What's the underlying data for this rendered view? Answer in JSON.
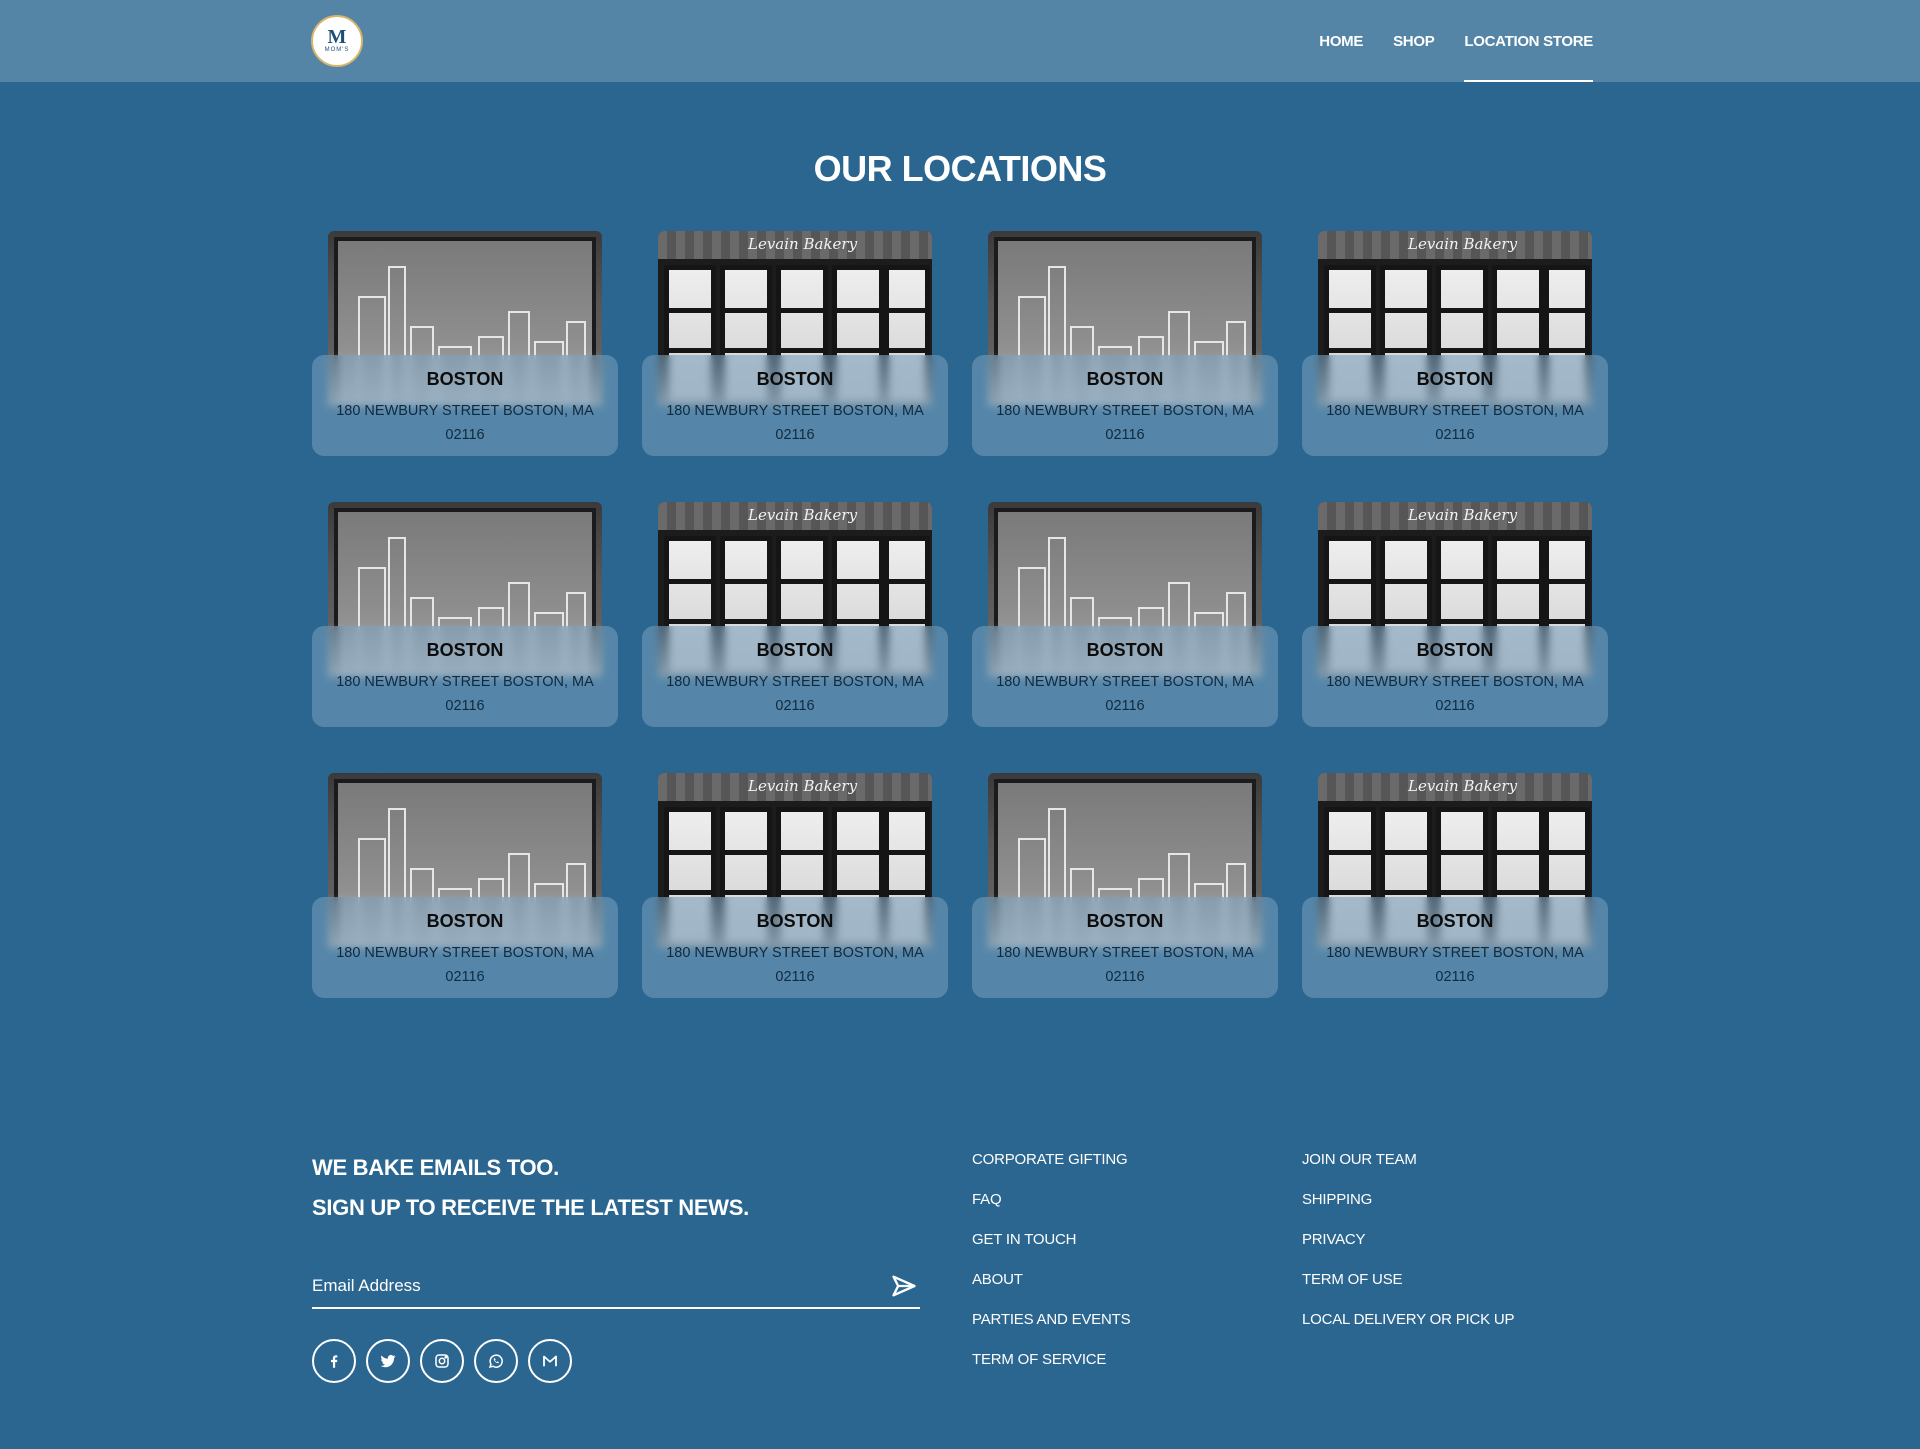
{
  "header": {
    "logo": {
      "mark": "M",
      "text": "MOM'S"
    },
    "nav": [
      {
        "label": "HOME",
        "active": false
      },
      {
        "label": "SHOP",
        "active": false
      },
      {
        "label": "LOCATION STORE",
        "active": true
      }
    ]
  },
  "main": {
    "title": "OUR LOCATIONS",
    "photo_text": "Levain Bakery",
    "locations": [
      {
        "city": "BOSTON",
        "address": "180 NEWBURY STREET BOSTON, MA 02116",
        "photo": "window-skyline"
      },
      {
        "city": "BOSTON",
        "address": "180 NEWBURY STREET BOSTON, MA 02116",
        "photo": "storefront"
      },
      {
        "city": "BOSTON",
        "address": "180 NEWBURY STREET BOSTON, MA 02116",
        "photo": "window-skyline"
      },
      {
        "city": "BOSTON",
        "address": "180 NEWBURY STREET BOSTON, MA 02116",
        "photo": "storefront"
      },
      {
        "city": "BOSTON",
        "address": "180 NEWBURY STREET BOSTON, MA 02116",
        "photo": "window-skyline"
      },
      {
        "city": "BOSTON",
        "address": "180 NEWBURY STREET BOSTON, MA 02116",
        "photo": "storefront"
      },
      {
        "city": "BOSTON",
        "address": "180 NEWBURY STREET BOSTON, MA 02116",
        "photo": "window-skyline"
      },
      {
        "city": "BOSTON",
        "address": "180 NEWBURY STREET BOSTON, MA 02116",
        "photo": "storefront"
      },
      {
        "city": "BOSTON",
        "address": "180 NEWBURY STREET BOSTON, MA 02116",
        "photo": "window-skyline"
      },
      {
        "city": "BOSTON",
        "address": "180 NEWBURY STREET BOSTON, MA 02116",
        "photo": "storefront"
      },
      {
        "city": "BOSTON",
        "address": "180 NEWBURY STREET BOSTON, MA 02116",
        "photo": "window-skyline"
      },
      {
        "city": "BOSTON",
        "address": "180 NEWBURY STREET BOSTON, MA 02116",
        "photo": "storefront"
      }
    ]
  },
  "footer": {
    "newsletter": {
      "line1": "WE BAKE EMAILS TOO.",
      "line2": "SIGN UP TO RECEIVE THE LATEST NEWS.",
      "email_placeholder": "Email Address",
      "email_value": ""
    },
    "socials": [
      {
        "name": "facebook-icon"
      },
      {
        "name": "twitter-icon"
      },
      {
        "name": "instagram-icon"
      },
      {
        "name": "whatsapp-icon"
      },
      {
        "name": "gmail-icon"
      }
    ],
    "links_col1": [
      "CORPORATE GIFTING",
      "FAQ",
      "GET IN TOUCH",
      "ABOUT",
      "PARTIES AND EVENTS",
      "TERM OF SERVICE"
    ],
    "links_col2": [
      "JOIN OUR TEAM",
      "SHIPPING",
      "PRIVACY",
      "TERM OF USE",
      "LOCAL DELIVERY OR PICK UP"
    ]
  },
  "colors": {
    "page_bg": "#2b6690",
    "header_bg": "#5485a6",
    "card_panel": "rgba(120,160,190,0.55)",
    "text": "#ffffff"
  }
}
